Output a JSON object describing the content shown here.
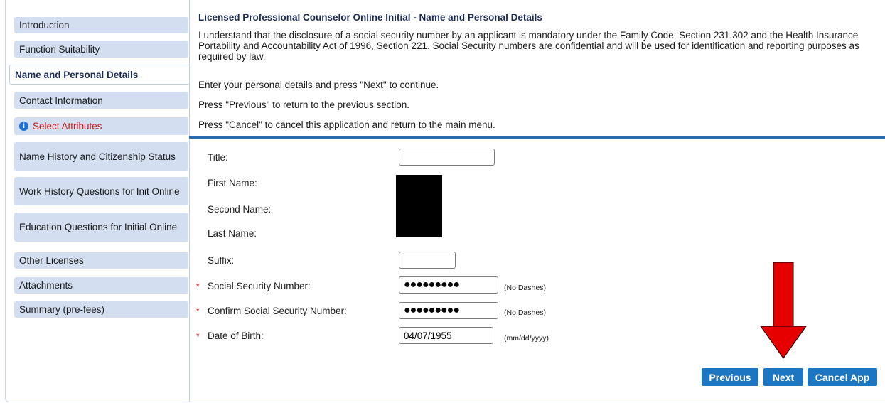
{
  "sidebar": {
    "items": [
      {
        "label": "Introduction"
      },
      {
        "label": "Function Suitability"
      },
      {
        "label": "Name and Personal Details"
      },
      {
        "label": "Contact Information"
      },
      {
        "label": "Select Attributes"
      },
      {
        "label": "Name History and Citizenship Status"
      },
      {
        "label": "Work History Questions for Init Online"
      },
      {
        "label": "Education Questions for Initial Online"
      },
      {
        "label": "Other Licenses"
      },
      {
        "label": "Attachments"
      },
      {
        "label": "Summary (pre-fees)"
      }
    ]
  },
  "header": {
    "title": "Licensed Professional Counselor Online Initial - Name and Personal Details",
    "disclosure": "I understand that the disclosure of a social security number by an applicant is mandatory under the Family Code, Section 231.302 and the Health Insurance Portability and Accountability Act of 1996, Section 221. Social Security numbers are confidential and will be used for identification and reporting purposes as required by law.",
    "instruction_next": "Enter your personal details and press \"Next\" to continue.",
    "instruction_prev": "Press \"Previous\" to return to the previous section.",
    "instruction_cancel": "Press \"Cancel\" to cancel this application and return to the main menu."
  },
  "form": {
    "title_label": "Title:",
    "title_value": "",
    "first_name_label": "First Name:",
    "second_name_label": "Second Name:",
    "last_name_label": "Last Name:",
    "suffix_label": "Suffix:",
    "suffix_value": "",
    "ssn_label": "Social Security Number:",
    "ssn_value": "●●●●●●●●●",
    "ssn_hint": "(No Dashes)",
    "confirm_ssn_label": "Confirm Social Security Number:",
    "confirm_ssn_value": "●●●●●●●●●",
    "confirm_ssn_hint": "(No Dashes)",
    "dob_label": "Date of Birth:",
    "dob_value": "04/07/1955",
    "dob_hint": "(mm/dd/yyyy)",
    "required_marker": "*"
  },
  "buttons": {
    "previous": "Previous",
    "next": "Next",
    "cancel": "Cancel App"
  },
  "colors": {
    "accent": "#1d76c1",
    "nav_bg": "#d3dff0",
    "error": "#d01818",
    "annotation_arrow": "#e60000"
  },
  "icons": {
    "select_attributes": "info-icon",
    "annotation": "arrow-down-icon"
  }
}
